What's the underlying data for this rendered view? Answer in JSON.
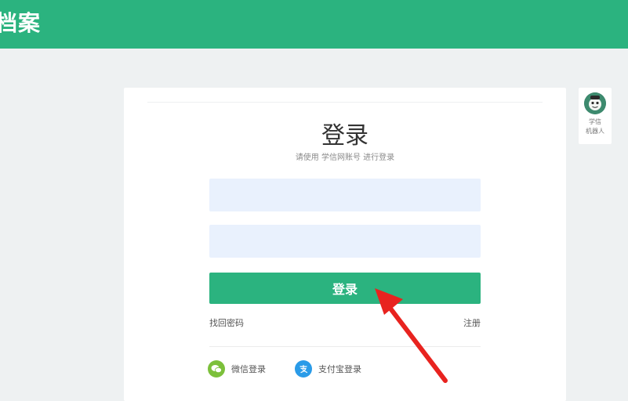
{
  "header": {
    "brand": "档案"
  },
  "login": {
    "title": "登录",
    "subtitle": "请使用 学信网账号 进行登录",
    "username_placeholder": "",
    "password_placeholder": "",
    "submit_label": "登录",
    "forgot_label": "找回密码",
    "register_label": "注册",
    "social": [
      {
        "label": "微信登录",
        "icon": "wechat-icon",
        "color": "#7cc03b"
      },
      {
        "label": "支付宝登录",
        "icon": "alipay-icon",
        "color": "#2a9be8"
      }
    ]
  },
  "robot": {
    "label_line1": "学信",
    "label_line2": "机器人"
  },
  "colors": {
    "accent": "#2bb37f",
    "input_bg": "#e9f1fd",
    "arrow": "#e8231f"
  }
}
